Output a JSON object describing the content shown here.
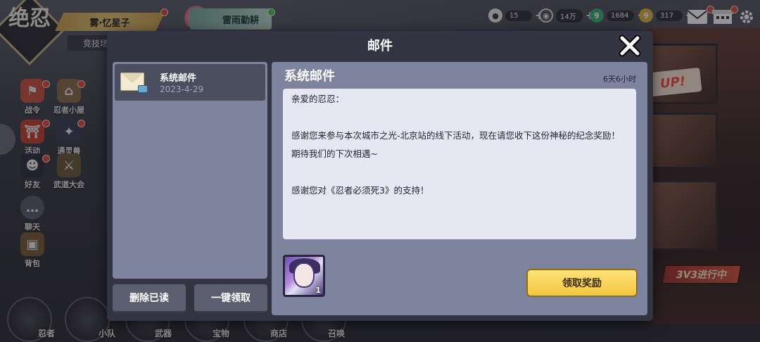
{
  "hud": {
    "logo_text": "绝忍",
    "player_name": "雾·忆星子",
    "rank_label": "竞技场",
    "event_label": "雷雨勤耕",
    "resources": [
      {
        "icon": "stone-icon",
        "value": "15"
      },
      {
        "icon": "coin-icon",
        "value": "14万"
      },
      {
        "icon": "green-jade-icon",
        "value": "1684"
      },
      {
        "icon": "gold-jade-icon",
        "value": "317"
      }
    ]
  },
  "left_menu": [
    {
      "id": "battle-pass",
      "label": "战令",
      "color": "#c8503e"
    },
    {
      "id": "ninja-house",
      "label": "忍者小屋",
      "color": "#8a6a48"
    },
    {
      "id": "events",
      "label": "活动",
      "color": "#c4402f"
    },
    {
      "id": "spirit-beast",
      "label": "通灵兽",
      "color": "#3a3d54"
    },
    {
      "id": "friends",
      "label": "好友",
      "color": "#2c2e3a"
    },
    {
      "id": "tournament",
      "label": "武道大会",
      "color": "#6a5a3a"
    },
    {
      "id": "chat",
      "label": "聊天",
      "color": "#5a5d68"
    },
    {
      "id": "backpack",
      "label": "背包",
      "color": "#7a5a3a"
    }
  ],
  "bottom_nav": [
    {
      "id": "ninja",
      "label": "忍者"
    },
    {
      "id": "squad",
      "label": "小队"
    },
    {
      "id": "weapon",
      "label": "武器"
    },
    {
      "id": "treasure",
      "label": "宝物"
    },
    {
      "id": "shop",
      "label": "商店"
    },
    {
      "id": "summon",
      "label": "召唤"
    }
  ],
  "side_banners": {
    "up_text": "UP!",
    "pvp_banner": "3V3进行中"
  },
  "mail": {
    "title": "邮件",
    "items": [
      {
        "title": "系统邮件",
        "date": "2023-4-29",
        "selected": true
      }
    ],
    "buttons": {
      "delete_read": "删除已读",
      "claim_all": "一键领取"
    },
    "detail": {
      "title": "系统邮件",
      "expires": "6天6小时",
      "greeting": "亲爱的忍忍：",
      "paragraph1": "感谢您来参与本次城市之光-北京站的线下活动，现在请您收下这份神秘的纪念奖励！期待我们的下次相遇~",
      "paragraph2": "感谢您对《忍者必须死3》的支持！",
      "reward": {
        "count": "1",
        "icon": "character-portrait-icon"
      },
      "claim_label": "领取奖励"
    }
  },
  "colors": {
    "modal_bg": "#343542",
    "panel_bg": "#7e849e",
    "letter_bg": "#e6e7f2",
    "claim_button": "#f2c53f",
    "notification_dot": "#e0473b"
  }
}
